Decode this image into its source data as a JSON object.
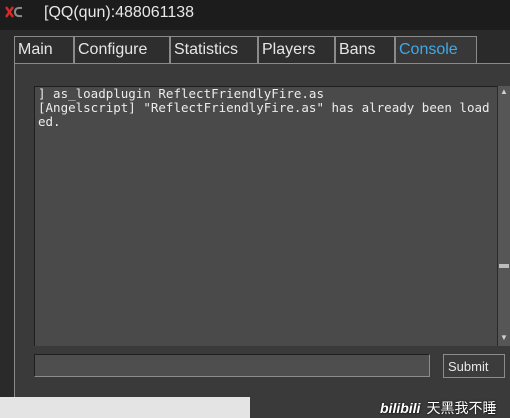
{
  "window": {
    "title": "[QQ(qun):488061138",
    "logo_icon": "app-logo-icon"
  },
  "tabs": [
    {
      "label": "Main",
      "active": false
    },
    {
      "label": "Configure",
      "active": false
    },
    {
      "label": "Statistics",
      "active": false
    },
    {
      "label": "Players",
      "active": false
    },
    {
      "label": "Bans",
      "active": false
    },
    {
      "label": "Console",
      "active": true
    }
  ],
  "console": {
    "log": "] as_loadplugin ReflectFriendlyFire.as\n[Angelscript] \"ReflectFriendlyFire.as\" has already been loaded.",
    "command_value": "",
    "submit_label": "Submit"
  },
  "watermark": {
    "logo": "bilibili",
    "text": "天黑我不睡"
  },
  "colors": {
    "active_tab": "#3fa9e8",
    "background": "#2a2a2a",
    "console_bg": "#4a4a4a"
  }
}
